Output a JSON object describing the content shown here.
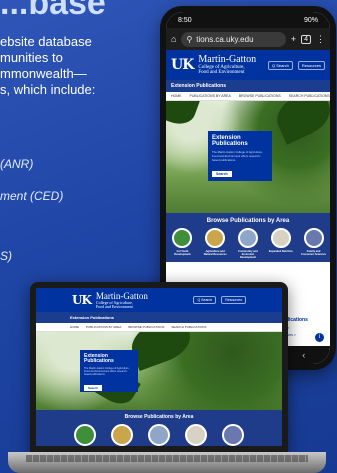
{
  "intro": {
    "heading": "...base",
    "lines": [
      "ebsite database",
      "munities to",
      "mmonwealth—",
      "s, which include:"
    ],
    "list": [
      "(ANR)",
      "ment (CED)",
      "S)"
    ]
  },
  "phone": {
    "time": "8:50",
    "battery": "90%",
    "url": "tions.ca.uky.edu",
    "tab_count": "4",
    "brand_title": "Martin-Gatton",
    "brand_sub1": "College of Agriculture,",
    "brand_sub2": "Food and Environment",
    "search_label": "Q Search",
    "resources_label": "Resources",
    "section_title": "Extension Publications",
    "nav_items": [
      "HOME",
      "PUBLICATIONS BY AREA",
      "BROWSE PUBLICATIONS",
      "SEARCH PUBLICATIONS"
    ],
    "hero_title": "Extension Publications",
    "hero_desc": "The Martin-Gatton College of Agriculture, Food and Environment offers research-based publications.",
    "hero_button": "Search",
    "browse_title": "Browse Publications by Area",
    "areas": [
      "4-H Youth Development",
      "Agriculture and Natural Resources",
      "Community and Economic Development",
      "Expanded Nutrition",
      "Family and Consumer Sciences"
    ],
    "browse_more": "e Publications",
    "browse_more_sub1": "Numero >",
    "browse_more_sub2": "Publications >"
  },
  "laptop": {
    "brand_title": "Martin-Gatton",
    "brand_sub1": "College of Agriculture,",
    "brand_sub2": "Food and Environment",
    "search_label": "Q Search",
    "resources_label": "Resources",
    "section_title": "Extension Publications",
    "nav_items": [
      "HOME",
      "PUBLICATIONS BY AREA",
      "BROWSE PUBLICATIONS",
      "SEARCH PUBLICATIONS"
    ],
    "hero_title": "Extension Publications",
    "hero_desc": "The Martin-Gatton College of Agriculture, Food and Environment offers research-based publications.",
    "hero_button": "Search",
    "browse_title": "Browse Publications by Area"
  },
  "colors": {
    "uk_blue": "#0033a0",
    "background": "#2148a8"
  }
}
